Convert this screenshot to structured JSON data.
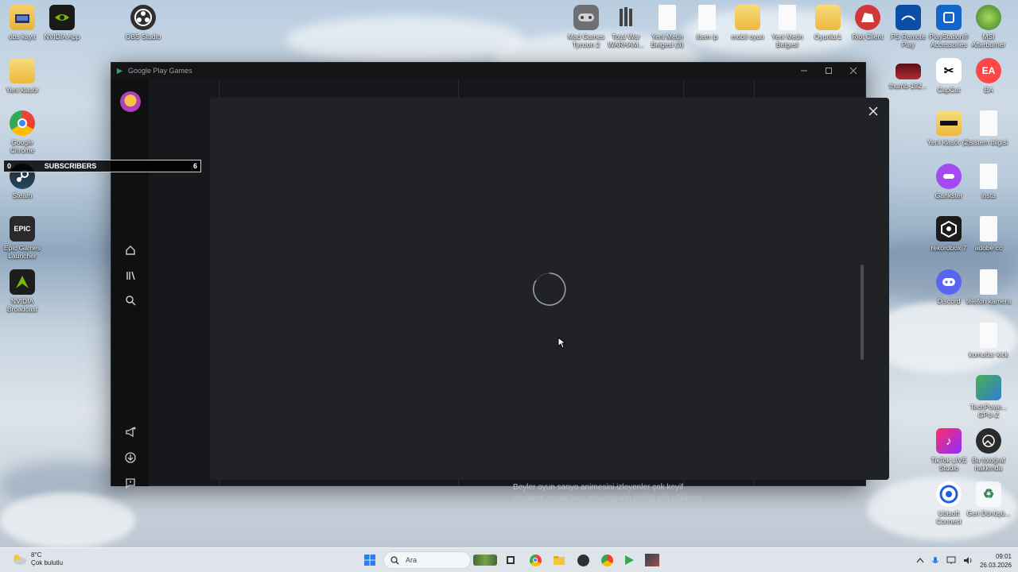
{
  "desktop": {
    "left_icons": [
      {
        "label": "obs kayıt",
        "icon": "folder-icon"
      },
      {
        "label": "NVIDIA App",
        "icon": "nvidia-icon"
      },
      {
        "label": "OBS Studio",
        "icon": "obs-icon"
      },
      {
        "label": "Yeni klasör",
        "icon": "folder-icon"
      },
      {
        "label": "Google Chrome",
        "icon": "chrome-icon"
      },
      {
        "label": "Steam",
        "icon": "steam-icon"
      },
      {
        "label": "Epic Games Launcher",
        "icon": "epic-icon"
      },
      {
        "label": "NVIDIA Broadcast",
        "icon": "nvidia-broadcast-icon"
      }
    ],
    "top_icons": [
      {
        "label": "Mad Games Tycoon 2",
        "icon": "gamepad-icon"
      },
      {
        "label": "Total War WARHAM...",
        "icon": "warhammer-icon"
      },
      {
        "label": "Yeni Metin Belgesi (3)",
        "icon": "text-file-icon"
      },
      {
        "label": "iltem ip",
        "icon": "text-file-icon"
      },
      {
        "label": "mobil oyun",
        "icon": "folder-icon"
      },
      {
        "label": "Yeni Metin Belgesi",
        "icon": "text-file-icon"
      },
      {
        "label": "Oyunlar1",
        "icon": "folder-icon"
      },
      {
        "label": "Riot Client",
        "icon": "riot-icon"
      },
      {
        "label": "PS Remote Play",
        "icon": "ps-remote-icon"
      },
      {
        "label": "PlayStation® Accessories",
        "icon": "playstation-icon"
      },
      {
        "label": "MSI Afterburner",
        "icon": "msi-icon"
      }
    ],
    "right_icons": [
      {
        "label": "thumb-192...",
        "icon": "image-file-icon"
      },
      {
        "label": "CapCut",
        "icon": "capcut-icon"
      },
      {
        "label": "EA",
        "icon": "ea-icon"
      },
      {
        "label": "Yeni klasör (2)",
        "icon": "folder-icon"
      },
      {
        "label": "sistem bilgisi",
        "icon": "text-file-icon"
      },
      {
        "label": "Gankster",
        "icon": "gankster-icon"
      },
      {
        "label": "insta",
        "icon": "text-file-icon"
      },
      {
        "label": "rekordbox 7",
        "icon": "rekordbox-icon"
      },
      {
        "label": "adobe cc",
        "icon": "text-file-icon"
      },
      {
        "label": "Discord",
        "icon": "discord-icon"
      },
      {
        "label": "telefon kamera",
        "icon": "text-file-icon"
      },
      {
        "label": "komutlar kick",
        "icon": "text-file-icon"
      },
      {
        "label": "TechPowe... GPU-Z",
        "icon": "gpuz-icon"
      },
      {
        "label": "TikTok LIVE Studio",
        "icon": "tiktok-icon"
      },
      {
        "label": "Bu fotoğraf hakkında",
        "icon": "photo-info-icon"
      },
      {
        "label": "Ubisoft Connect",
        "icon": "ubisoft-icon"
      },
      {
        "label": "Geri Dönüşü...",
        "icon": "recycle-bin-icon"
      }
    ]
  },
  "subscribers": {
    "left_value": "0",
    "label": "SUBSCRIBERS",
    "right_value": "6"
  },
  "window": {
    "title": "Google Play Games",
    "description_line1": "Beyler oyun sanyo animesini izleyenler çok keyif",
    "description_line2": "alacaktır, ancak bazı arkadaşların dediği gibi yükleme"
  },
  "sidebar": {
    "items": [
      {
        "name": "home",
        "icon": "home-icon"
      },
      {
        "name": "library",
        "icon": "library-icon"
      },
      {
        "name": "search",
        "icon": "search-icon"
      },
      {
        "name": "announcements",
        "icon": "megaphone-icon"
      },
      {
        "name": "downloads",
        "icon": "download-icon"
      },
      {
        "name": "feedback",
        "icon": "feedback-icon"
      }
    ]
  },
  "taskbar": {
    "weather_temp": "8°C",
    "weather_desc": "Çok bulutlu",
    "search_placeholder": "Ara",
    "time": "09:01",
    "date": "26.03.2026"
  },
  "colors": {
    "window_bg": "#131416",
    "modal_bg": "#202226",
    "sidebar_bg": "#0f1012",
    "text_muted": "#9aa0a6"
  }
}
